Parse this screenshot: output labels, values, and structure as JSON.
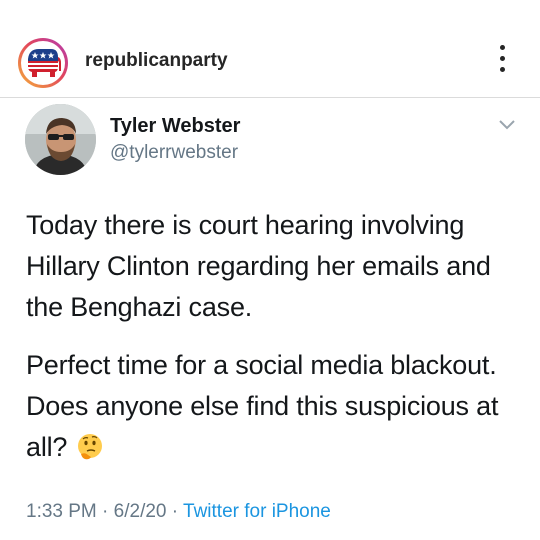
{
  "instagram": {
    "username": "republicanparty",
    "avatar_icon": "gop-elephant-logo",
    "more_icon": "three-dots-vertical-icon"
  },
  "tweet": {
    "name": "Tyler Webster",
    "handle": "@tylerrwebster",
    "paragraph1": "Today there is court hearing involving Hillary Clinton regarding her emails and the Benghazi case.",
    "paragraph2": "Perfect time for a social media blackout. Does anyone else find this suspicious at all?",
    "emoji": "thinking-face",
    "time": "1:33 PM",
    "date": "6/2/20",
    "separator": "·",
    "source": "Twitter for iPhone"
  },
  "colors": {
    "link": "#1b95e0",
    "secondary_text": "#657786",
    "text": "#14171a"
  }
}
